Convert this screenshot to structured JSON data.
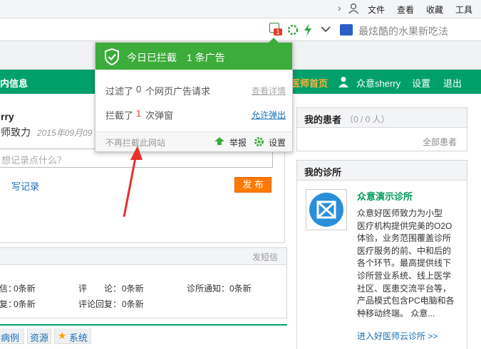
{
  "browser": {
    "menu": [
      "文件",
      "查看",
      "收藏",
      "工具"
    ],
    "blocked_badge": "1",
    "search_placeholder": "最炫酷的水果新吃法"
  },
  "nav": {
    "left_label": "内信息",
    "home": "医师首页",
    "user": "众意sherry",
    "settings": "设置",
    "logout": "退出"
  },
  "profile": {
    "name": "rry",
    "desc": "师致力",
    "date": "2015年09月09",
    "placeholder": "想记录点什么？",
    "write_link": "写记录",
    "publish": "发 布"
  },
  "messages": {
    "send_sms": "发短信",
    "rows": [
      [
        {
          "label": "信：",
          "value": "0条新"
        },
        {
          "label": "评　　论：",
          "value": "0条新"
        },
        {
          "label": "诊所通知：",
          "value": "0条新"
        }
      ],
      [
        {
          "label": "复：",
          "value": "0条新"
        },
        {
          "label": "评论回复：",
          "value": "0条新"
        }
      ]
    ]
  },
  "tabs": [
    "病例",
    "资源",
    "系统"
  ],
  "patients": {
    "title": "我的患者",
    "count": "（0 / 0 人）",
    "all": "全部患者"
  },
  "clinic": {
    "title": "我的诊所",
    "name": "众意演示诊所",
    "desc_lines": [
      "众意好医师致力为小型",
      "医疗机构提供完美的O2O",
      "体验，业务范围覆盖诊所",
      "医疗服务的前、中和后的",
      "各个环节。最高提供线下",
      "诊所营业系统、线上医学",
      "社区、医患交流平台等，",
      "产品模式包含PC电脑和各",
      "种移动终端。 众意..."
    ],
    "link": "进入好医师云诊所 >>"
  },
  "popup": {
    "title": "今日已拦截",
    "count_text": "1 条广告",
    "filter_prefix": "过滤了",
    "filter_count": "0",
    "filter_suffix": "个网页广告请求",
    "view_details": "查看详情",
    "block_prefix": "拦截了",
    "block_count": "1",
    "block_suffix": "次弹窗",
    "allow_popups": "允许弹出",
    "no_block_site": "不再拦截此网站",
    "report": "举报",
    "settings": "设置"
  },
  "colors": {
    "nav_green": "#00a06a",
    "popup_green": "#3cac3a",
    "home_orange": "#ffb236",
    "link_blue": "#1a6fb8",
    "publish_orange": "#ff7a00",
    "arrow_red": "#e8302c"
  }
}
